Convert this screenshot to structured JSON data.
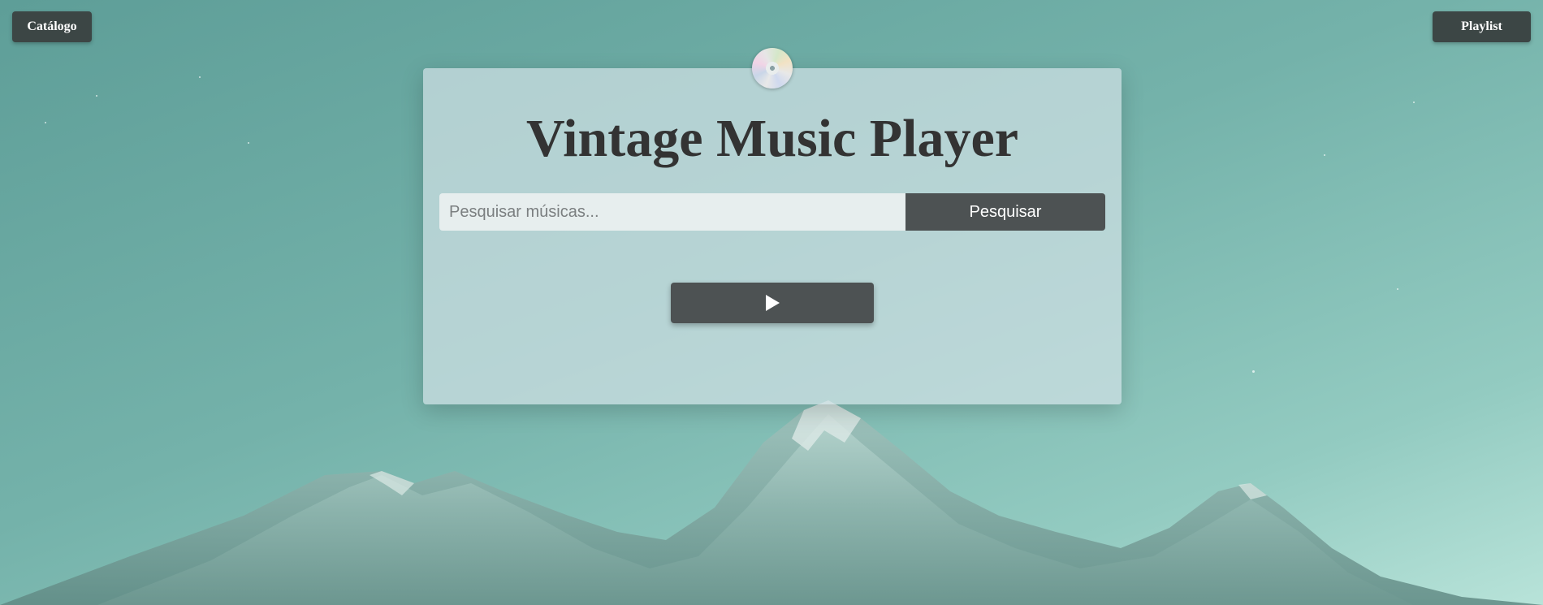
{
  "nav": {
    "catalog_label": "Catálogo",
    "playlist_label": "Playlist"
  },
  "player": {
    "title": "Vintage Music Player",
    "search_placeholder": "Pesquisar músicas...",
    "search_value": "",
    "search_button_label": "Pesquisar",
    "play_icon": "play-icon",
    "disc_icon": "cd-disc-icon"
  },
  "colors": {
    "button_dark": "#4d5253",
    "nav_button": "#3c4645",
    "title_text": "#333333",
    "panel_bg": "#d0e0e4"
  }
}
